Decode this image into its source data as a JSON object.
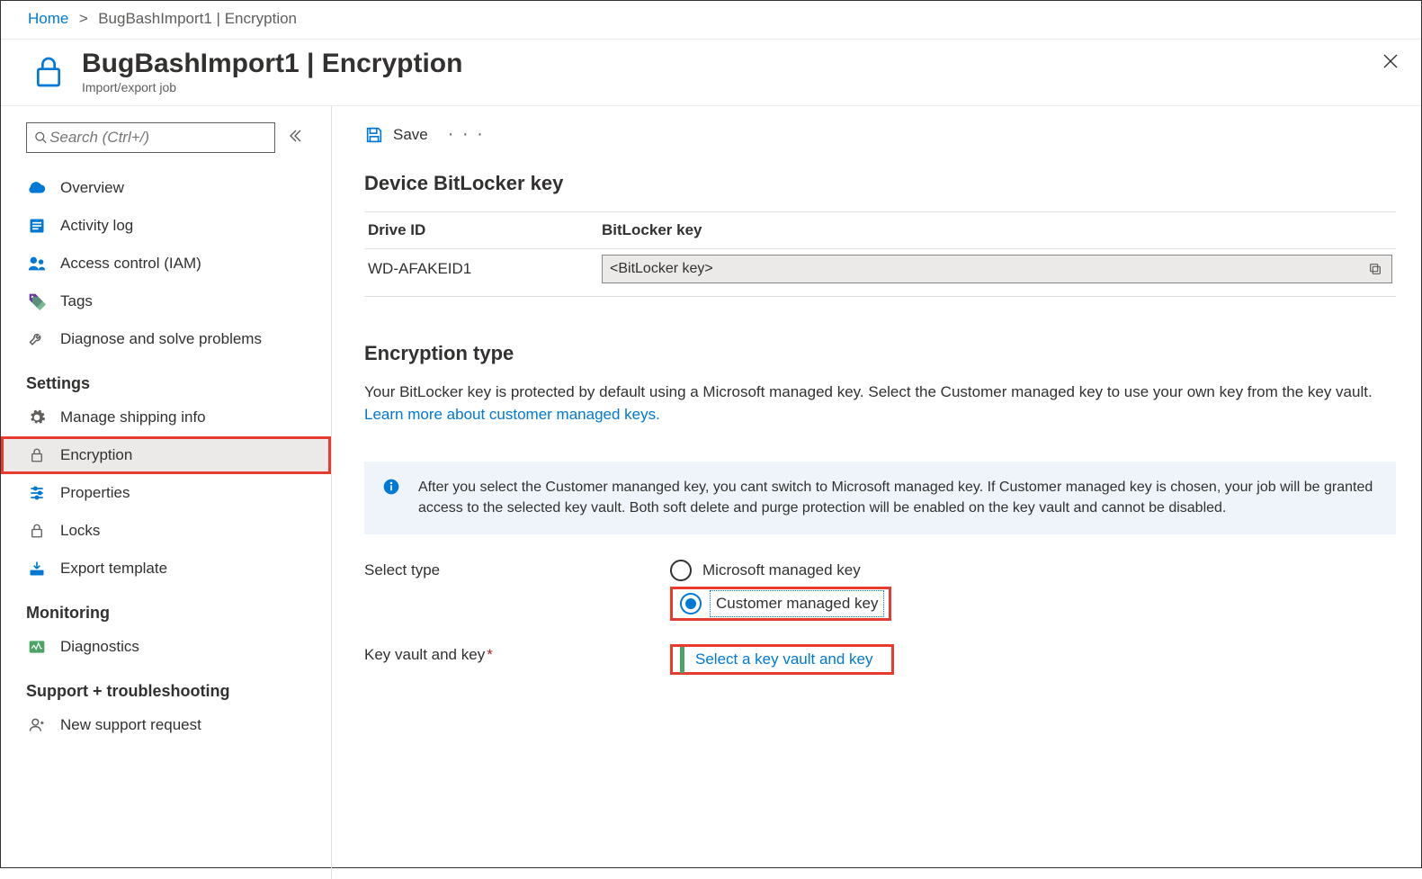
{
  "breadcrumb": {
    "home": "Home",
    "current": "BugBashImport1 | Encryption"
  },
  "header": {
    "title": "BugBashImport1 | Encryption",
    "subtitle": "Import/export job"
  },
  "search": {
    "placeholder": "Search (Ctrl+/)"
  },
  "nav": {
    "overview": "Overview",
    "activity": "Activity log",
    "iam": "Access control (IAM)",
    "tags": "Tags",
    "diagnose": "Diagnose and solve problems",
    "settings_h": "Settings",
    "shipping": "Manage shipping info",
    "encryption": "Encryption",
    "properties": "Properties",
    "locks": "Locks",
    "export": "Export template",
    "monitoring_h": "Monitoring",
    "diagnostics": "Diagnostics",
    "support_h": "Support + troubleshooting",
    "support_req": "New support request"
  },
  "toolbar": {
    "save": "Save"
  },
  "bitlocker": {
    "heading": "Device BitLocker key",
    "col_drive": "Drive ID",
    "col_key": "BitLocker key",
    "drive_id": "WD-AFAKEID1",
    "key_value": "<BitLocker key>"
  },
  "encryption_type": {
    "heading": "Encryption type",
    "desc": "Your BitLocker key is protected by default using a Microsoft managed key. Select the Customer managed key to use your own key from the key vault.",
    "learn_more": "Learn more about customer managed keys.",
    "info": "After you select the Customer mananged key, you cant switch to Microsoft managed key. If Customer managed key is chosen, your job will be granted access to the selected key vault. Both soft delete and purge protection will be enabled on the key vault and cannot be disabled.",
    "select_type_label": "Select type",
    "opt_ms": "Microsoft managed key",
    "opt_cust": "Customer managed key",
    "kv_label": "Key vault and key",
    "kv_link": "Select a key vault and key"
  }
}
